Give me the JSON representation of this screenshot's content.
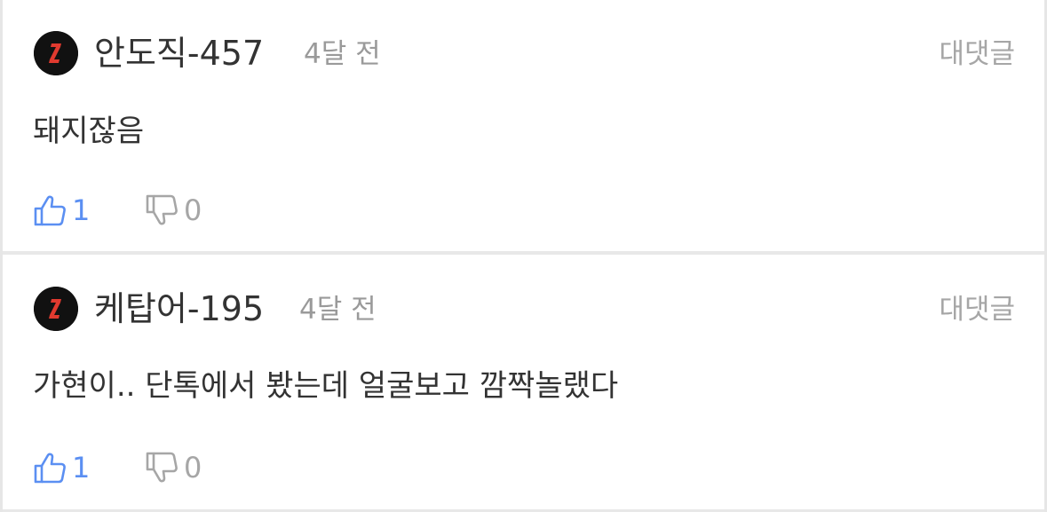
{
  "colors": {
    "like": "#5b8ff2",
    "dislike": "#a6a6a6",
    "text": "#333333",
    "meta": "#9a9a9a",
    "avatar_bg": "#111111",
    "avatar_accent": "#e03a2f"
  },
  "comments": [
    {
      "username": "안도직-457",
      "time": "4달 전",
      "reply_label": "대댓글",
      "text": "돼지잖음",
      "likes": "1",
      "dislikes": "0",
      "avatar_icon": "brand-logo-icon"
    },
    {
      "username": "케탑어-195",
      "time": "4달 전",
      "reply_label": "대댓글",
      "text": "가현이.. 단톡에서 봤는데 얼굴보고 깜짝놀랬다",
      "likes": "1",
      "dislikes": "0",
      "avatar_icon": "brand-logo-icon"
    }
  ]
}
